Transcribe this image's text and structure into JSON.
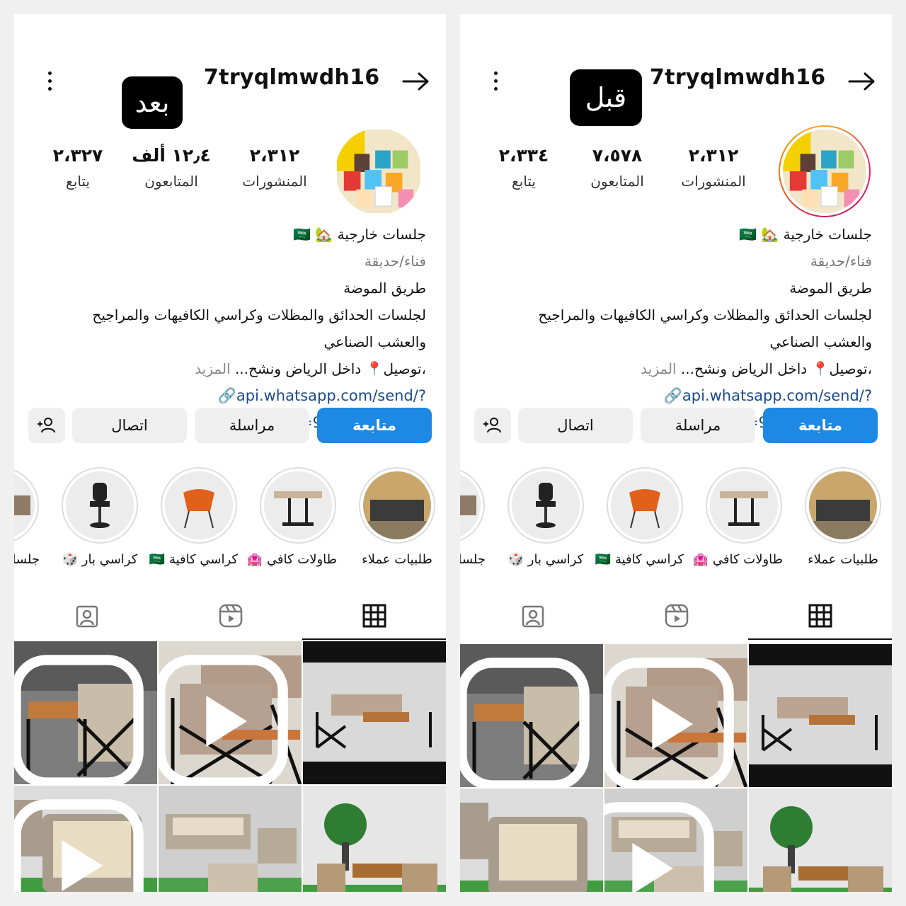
{
  "panels": [
    {
      "tag": "بعد",
      "username": "7tryqlmwdh16",
      "stats": [
        {
          "num": "٢،٣١٢",
          "label": "المنشورات"
        },
        {
          "num": "١٢٫٤ ألف",
          "label": "المتابعون"
        },
        {
          "num": "٢،٣٢٧",
          "label": "يتابع"
        }
      ],
      "bio": {
        "name": "جلسات خارجية 🏡 🇸🇦",
        "category": "فناء/حديقة",
        "lines": [
          "طريق الموضة",
          "لجلسات الحدائق والمظلات وكراسي الكافيهات والمراجيح",
          "والعشب الصناعي"
        ],
        "delivery": "،توصيل📍 داخل الرياض ونشح...",
        "more": "المزيد",
        "link": "api.whatsapp.com/send/?phone=966551673491"
      },
      "buttons": {
        "follow": "متابعة",
        "message": "مراسلة",
        "call": "اتصال"
      },
      "highlights": [
        "طلبيات عملاء",
        "طاولات كافي 🏩",
        "كراسي كافية 🇸🇦",
        "كراسي بار 🎲",
        "جلسات"
      ]
    },
    {
      "tag": "قبل",
      "username": "7tryqlmwdh16",
      "stats": [
        {
          "num": "٢،٣١٢",
          "label": "المنشورات"
        },
        {
          "num": "٧،٥٧٨",
          "label": "المتابعون"
        },
        {
          "num": "٢،٣٣٤",
          "label": "يتابع"
        }
      ],
      "bio": {
        "name": "جلسات خارجية 🏡 🇸🇦",
        "category": "فناء/حديقة",
        "lines": [
          "طريق الموضة",
          "لجلسات الحدائق والمظلات وكراسي الكافيهات والمراجيح",
          "والعشب الصناعي"
        ],
        "delivery": "،توصيل📍 داخل الرياض ونشح...",
        "more": "المزيد",
        "link": "api.whatsapp.com/send/?phone=966551673491"
      },
      "buttons": {
        "follow": "متابعة",
        "message": "مراسلة",
        "call": "اتصال"
      },
      "highlights": [
        "طلبيات عملاء",
        "طاولات كافي 🏩",
        "كراسي كافية 🇸🇦",
        "كراسي بار 🎲",
        "جلسات"
      ]
    }
  ],
  "icons": {
    "menu": "more-vertical-icon",
    "back": "arrow-right-icon",
    "add_user": "add-person-icon",
    "tab_grid": "grid-icon",
    "tab_reels": "reels-icon",
    "tab_tagged": "tagged-icon",
    "reel_badge": "reel-badge-icon"
  },
  "colors": {
    "follow_button": "#1e88e5",
    "link": "#1a4a8c",
    "story_ring": "#e91e63"
  }
}
